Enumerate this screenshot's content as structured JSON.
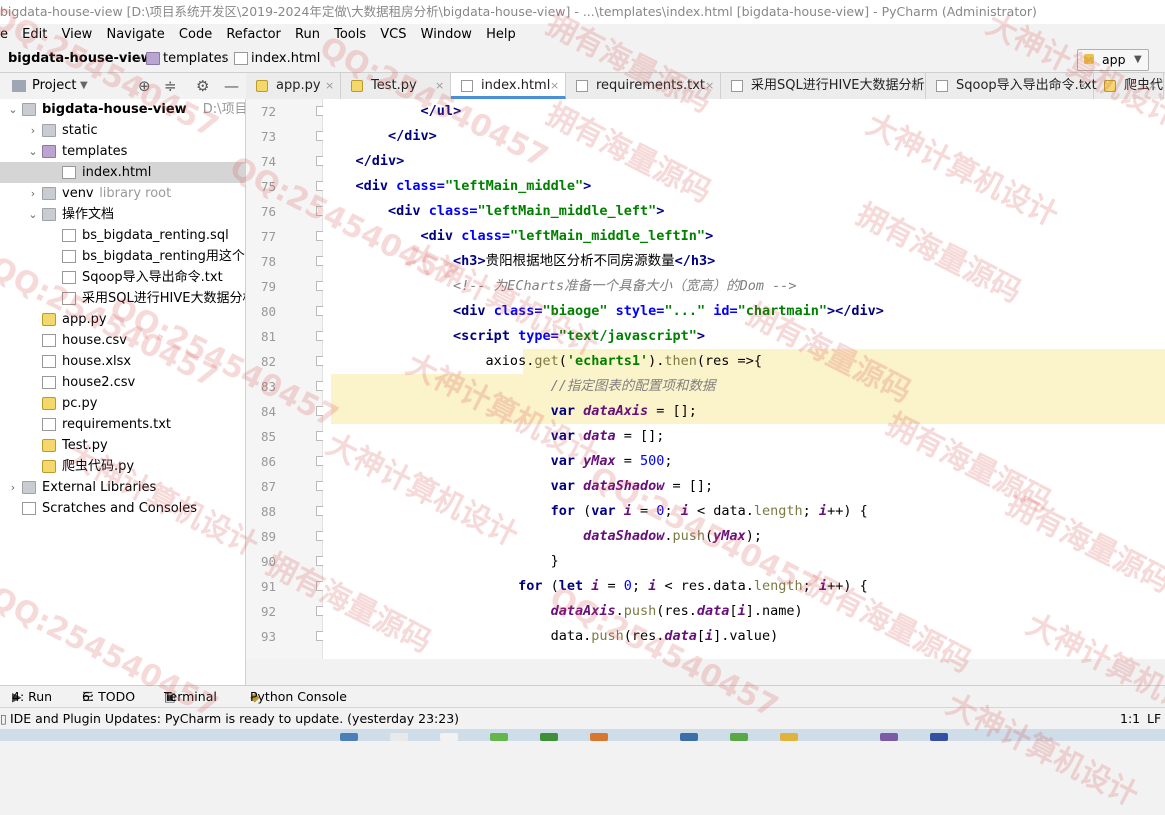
{
  "window": {
    "title": "bigdata-house-view [D:\\项目系统开发区\\2019-2024年定做\\大数据租房分析\\bigdata-house-view] - ...\\templates\\index.html [bigdata-house-view] - PyCharm (Administrator)"
  },
  "menu": [
    "e",
    "Edit",
    "View",
    "Navigate",
    "Code",
    "Refactor",
    "Run",
    "Tools",
    "VCS",
    "Window",
    "Help"
  ],
  "breadcrumb": {
    "project": "bigdata-house-view",
    "folder": "templates",
    "file": "index.html"
  },
  "run_config": {
    "label": "app"
  },
  "sidebar": {
    "header": "Project",
    "tree": [
      {
        "label": "bigdata-house-view",
        "extra": "D:\\项目系统开",
        "indent": 0,
        "arrow": "down",
        "icon": "folder",
        "bold": true
      },
      {
        "label": "static",
        "indent": 1,
        "arrow": "right",
        "icon": "folder"
      },
      {
        "label": "templates",
        "indent": 1,
        "arrow": "down",
        "icon": "folder-purple"
      },
      {
        "label": "index.html",
        "indent": 2,
        "arrow": "",
        "icon": "html-file",
        "selected": true
      },
      {
        "label": "venv",
        "extra": "library root",
        "indent": 1,
        "arrow": "right",
        "icon": "folder"
      },
      {
        "label": "操作文档",
        "indent": 1,
        "arrow": "down",
        "icon": "folder"
      },
      {
        "label": "bs_bigdata_renting.sql",
        "indent": 2,
        "arrow": "",
        "icon": "sql-file"
      },
      {
        "label": "bs_bigdata_renting用这个.sq",
        "indent": 2,
        "arrow": "",
        "icon": "sql-file"
      },
      {
        "label": "Sqoop导入导出命令.txt",
        "indent": 2,
        "arrow": "",
        "icon": "text-file"
      },
      {
        "label": "采用SQL进行HIVE大数据分析",
        "indent": 2,
        "arrow": "",
        "icon": "text-file"
      },
      {
        "label": "app.py",
        "indent": 1,
        "arrow": "",
        "icon": "python-file"
      },
      {
        "label": "house.csv",
        "indent": 1,
        "arrow": "",
        "icon": "text-file"
      },
      {
        "label": "house.xlsx",
        "indent": 1,
        "arrow": "",
        "icon": "text-file"
      },
      {
        "label": "house2.csv",
        "indent": 1,
        "arrow": "",
        "icon": "text-file"
      },
      {
        "label": "pc.py",
        "indent": 1,
        "arrow": "",
        "icon": "python-file"
      },
      {
        "label": "requirements.txt",
        "indent": 1,
        "arrow": "",
        "icon": "text-file"
      },
      {
        "label": "Test.py",
        "indent": 1,
        "arrow": "",
        "icon": "python-file"
      },
      {
        "label": "爬虫代码.py",
        "indent": 1,
        "arrow": "",
        "icon": "python-file"
      },
      {
        "label": "External Libraries",
        "indent": 0,
        "arrow": "right",
        "icon": "library"
      },
      {
        "label": "Scratches and Consoles",
        "indent": 0,
        "arrow": "",
        "icon": "scratch"
      }
    ]
  },
  "tabs": [
    {
      "label": "app.py",
      "icon": "python-file"
    },
    {
      "label": "Test.py",
      "icon": "python-file"
    },
    {
      "label": "index.html",
      "icon": "html-file",
      "active": true
    },
    {
      "label": "requirements.txt",
      "icon": "text-file"
    },
    {
      "label": "采用SQL进行HIVE大数据分析",
      "icon": "text-file"
    },
    {
      "label": "Sqoop导入导出命令.txt",
      "icon": "text-file"
    },
    {
      "label": "爬虫代",
      "icon": "python-file"
    }
  ],
  "editor": {
    "line_numbers": [
      "72",
      "73",
      "74",
      "75",
      "76",
      "77",
      "78",
      "79",
      "80",
      "81",
      "82",
      "83",
      "84",
      "85",
      "86",
      "87",
      "88",
      "89",
      "90",
      "91",
      "92",
      "93"
    ],
    "lines": [
      "            </ul>",
      "        </div>",
      "    </div>",
      "    <div class=\"leftMain_middle\">",
      "        <div class=\"leftMain_middle_left\">",
      "            <div class=\"leftMain_middle_leftIn\">",
      "                <h3>贵阳根据地区分析不同房源数量</h3>",
      "                <!-- 为ECharts准备一个具备大小（宽高）的Dom -->",
      "                <div class=\"biaoge\" style=\"...\" id=\"chartmain\"></div>",
      "                <script type=\"text/javascript\">",
      "                    axios.get('echarts1').then(res =>{",
      "                            //指定图表的配置项和数据",
      "                            var dataAxis = [];",
      "                            var data = [];",
      "                            var yMax = 500;",
      "                            var dataShadow = [];",
      "                            for (var i = 0; i < data.length; i++) {",
      "                                dataShadow.push(yMax);",
      "                            }",
      "                        for (let i = 0; i < res.data.length; i++) {",
      "                            dataAxis.push(res.data[i].name)",
      "                            data.push(res.data[i].value)"
    ]
  },
  "bottom_tools": [
    {
      "label": "4: Run",
      "icon": "run-icon"
    },
    {
      "label": "6: TODO",
      "icon": "todo-icon"
    },
    {
      "label": "Terminal",
      "icon": "terminal-icon"
    },
    {
      "label": "Python Console",
      "icon": "python-console-icon"
    }
  ],
  "status": {
    "message": "IDE and Plugin Updates: PyCharm is ready to update. (yesterday 23:23)",
    "position": "1:1",
    "line_sep": "LF"
  },
  "watermarks": [
    "QQ:254540457",
    "拥有海量源码",
    "大神计算机设计"
  ]
}
